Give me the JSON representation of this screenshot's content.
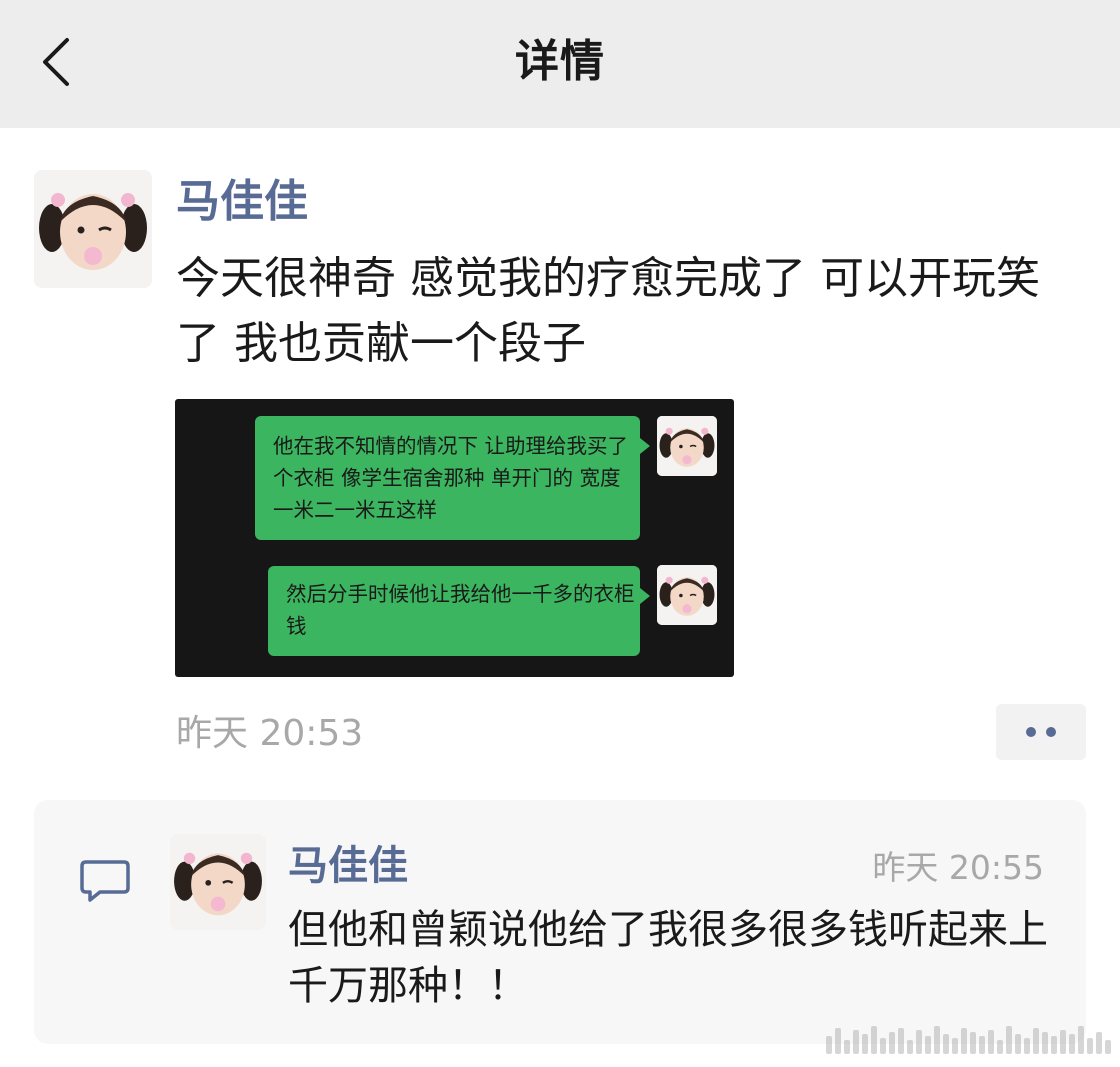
{
  "header": {
    "title": "详情",
    "back_icon": "chevron-left-icon"
  },
  "post": {
    "author": "马佳佳",
    "text": "今天很神奇 感觉我的疗愈完成了 可以开玩笑了 我也贡献一个段子",
    "time": "昨天 20:53",
    "more_icon": "more-dots-icon",
    "screenshot": {
      "messages": [
        {
          "text": "他在我不知情的情况下 让助理给我买了个衣柜 像学生宿舍那种 单开门的 宽度一米二一米五这样"
        },
        {
          "text": "然后分手时候他让我给他一千多的衣柜钱"
        }
      ]
    }
  },
  "comment": {
    "icon": "comment-icon",
    "author": "马佳佳",
    "time": "昨天 20:55",
    "text": "但他和曾颖说他给了我很多很多钱听起来上千万那种！！"
  },
  "colors": {
    "header_bg": "#ededed",
    "name_blue": "#576b95",
    "bubble_green": "#3bb55f",
    "chat_bg": "#161616",
    "muted_gray": "#a8a8a8",
    "card_bg": "#f7f7f7"
  }
}
